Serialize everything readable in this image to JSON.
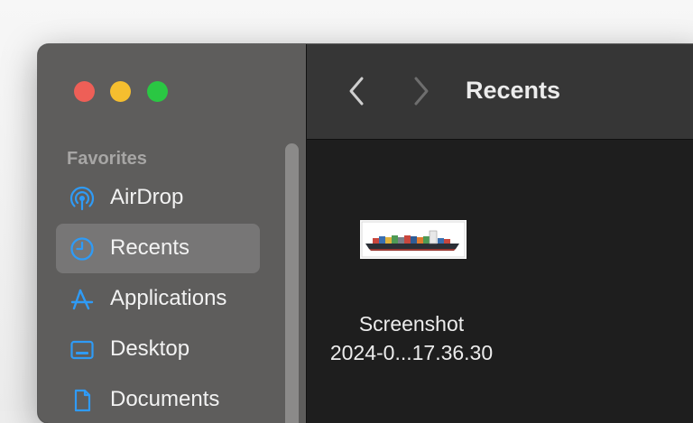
{
  "window": {
    "title": "Recents",
    "controls": [
      "close",
      "minimize",
      "zoom"
    ]
  },
  "sidebar": {
    "section_title": "Favorites",
    "items": [
      {
        "label": "AirDrop",
        "icon": "airdrop-icon",
        "selected": false
      },
      {
        "label": "Recents",
        "icon": "clock-icon",
        "selected": true
      },
      {
        "label": "Applications",
        "icon": "applications-icon",
        "selected": false
      },
      {
        "label": "Desktop",
        "icon": "desktop-icon",
        "selected": false
      },
      {
        "label": "Documents",
        "icon": "document-icon",
        "selected": false
      }
    ]
  },
  "toolbar": {
    "back_icon": "chevron-left-icon",
    "forward_icon": "chevron-right-icon",
    "title": "Recents"
  },
  "files": [
    {
      "name_line1": "Screenshot",
      "name_line2": "2024-0...17.36.30",
      "thumbnail": "container-ship-image"
    }
  ],
  "colors": {
    "accent": "#2f9bf6",
    "sidebar_bg": "#5e5d5c",
    "selected_bg": "#777676",
    "toolbar_bg": "#363636",
    "content_bg": "#1e1e1e"
  }
}
